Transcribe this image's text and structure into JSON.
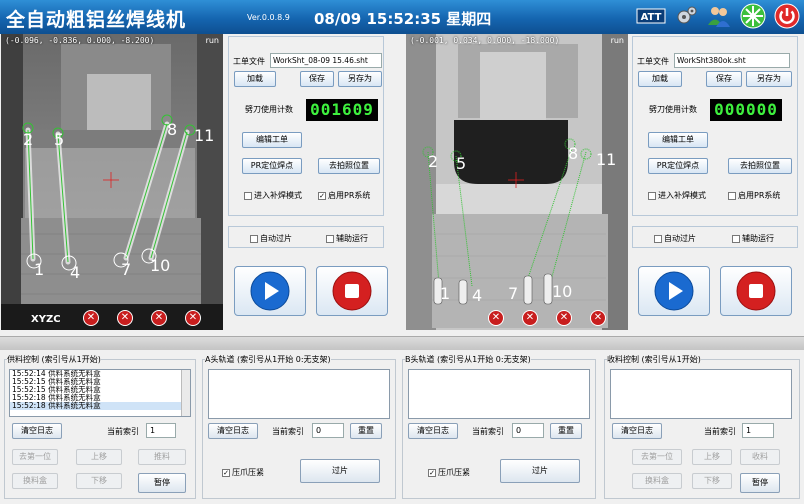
{
  "header": {
    "title": "全自动粗铝丝焊线机",
    "version": "Ver.0.0.8.9",
    "datetime": "08/09 15:52:35 星期四",
    "icons": [
      "logo-icon",
      "gears-icon",
      "users-icon",
      "network-icon",
      "power-icon"
    ]
  },
  "camera_left": {
    "coords": "(-0.096, -0.836, 0.000, -8.200)",
    "mode": "run",
    "axis_label": "XYZC",
    "top_points": [
      "2",
      "5",
      "8",
      "11"
    ],
    "bottom_points": [
      "1",
      "4",
      "7",
      "10"
    ]
  },
  "camera_right": {
    "coords": "(-0.001, 0.034, 0.000, -18.000)",
    "mode": "run",
    "top_points": [
      "2",
      "5",
      "8",
      "11"
    ],
    "bottom_points": [
      "1",
      "4",
      "7",
      "10"
    ]
  },
  "panel_left": {
    "file_label": "工单文件",
    "file_value": "WorkSht_08-09 15.46.sht",
    "load": "加载",
    "save": "保存",
    "save_as": "另存为",
    "counter_label": "劈刀使用计数",
    "counter_value": "001609",
    "edit_order": "编辑工单",
    "pr_locate": "PR定位焊点",
    "goto_photo": "去拍照位置",
    "enter_repair": "进入补焊模式",
    "enable_pr": "启用PR系统",
    "enable_pr_checked": true,
    "auto_pass": "自动过片",
    "assist_run": "辅助运行"
  },
  "panel_right": {
    "file_label": "工单文件",
    "file_value": "WorkSht380ok.sht",
    "load": "加载",
    "save": "保存",
    "save_as": "另存为",
    "counter_label": "劈刀使用计数",
    "counter_value": "000000",
    "edit_order": "编辑工单",
    "pr_locate": "PR定位焊点",
    "goto_photo": "去拍照位置",
    "enter_repair": "进入补焊模式",
    "enable_pr": "启用PR系统",
    "enable_pr_checked": false,
    "auto_pass": "自动过片",
    "assist_run": "辅助运行"
  },
  "feed": {
    "title": "供料控制 (索引号从1开始)",
    "log": [
      "15:52:14 供料系统无料盒",
      "15:52:15 供料系统无料盒",
      "15:52:15 供料系统无料盒",
      "15:52:18 供料系统无料盒",
      "15:52:18 供料系统无料盒"
    ],
    "clear_log": "清空日志",
    "index_label": "当前索引",
    "index_value": "1",
    "first": "去第一位",
    "up": "上移",
    "push": "推料",
    "change_box": "换料盒",
    "down": "下移",
    "pause": "暂停"
  },
  "track_a": {
    "title": "A头轨道 (索引号从1开始 0:无支架)",
    "clear_log": "清空日志",
    "index_label": "当前索引",
    "index_value": "0",
    "reset": "重置",
    "clamp": "压爪压紧",
    "pass": "过片"
  },
  "track_b": {
    "title": "B头轨道 (索引号从1开始 0:无支架)",
    "clear_log": "清空日志",
    "index_label": "当前索引",
    "index_value": "0",
    "reset": "重置",
    "clamp": "压爪压紧",
    "pass": "过片"
  },
  "collect": {
    "title": "收料控制 (索引号从1开始)",
    "clear_log": "清空日志",
    "index_label": "当前索引",
    "index_value": "1",
    "first": "去第一位",
    "up": "上移",
    "collect": "收料",
    "change_box": "换料盒",
    "down": "下移",
    "pause": "暂停"
  },
  "colors": {
    "title_bar": "#1f74c2",
    "counter_text": "#3ef03e",
    "play": "#1a6ad0",
    "stop": "#d42020"
  }
}
